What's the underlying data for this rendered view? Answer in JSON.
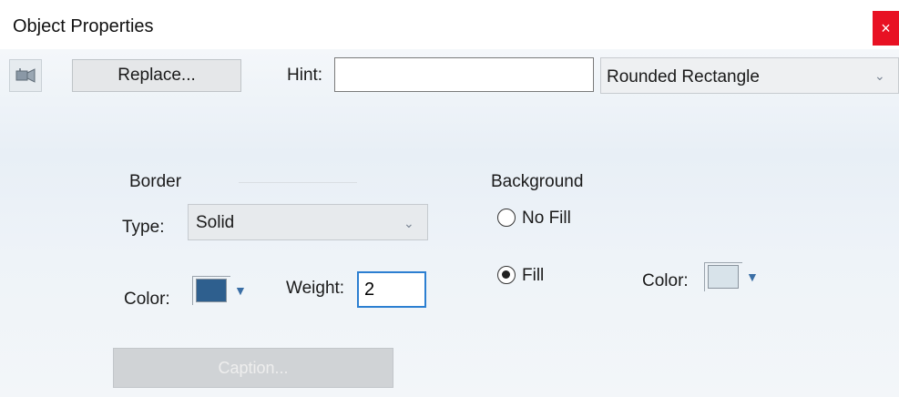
{
  "window": {
    "title": "Object Properties",
    "close_symbol": "×"
  },
  "toolbar": {
    "icon_name": "object-link-icon",
    "replace_label": "Replace...",
    "hint_label": "Hint:",
    "hint_value": "",
    "shape_value": "Rounded Rectangle"
  },
  "border": {
    "group_label": "Border",
    "type_label": "Type:",
    "type_value": "Solid",
    "color_label": "Color:",
    "color_value": "#2e5f8e",
    "weight_label": "Weight:",
    "weight_value": "2"
  },
  "caption_label": "Caption...",
  "background": {
    "group_label": "Background",
    "no_fill_label": "No Fill",
    "fill_label": "Fill",
    "selected": "Fill",
    "color_label": "Color:",
    "color_value": "#d8e3ea"
  },
  "colors": {
    "close_bg": "#e81123",
    "focus_border": "#2c7fd1"
  }
}
